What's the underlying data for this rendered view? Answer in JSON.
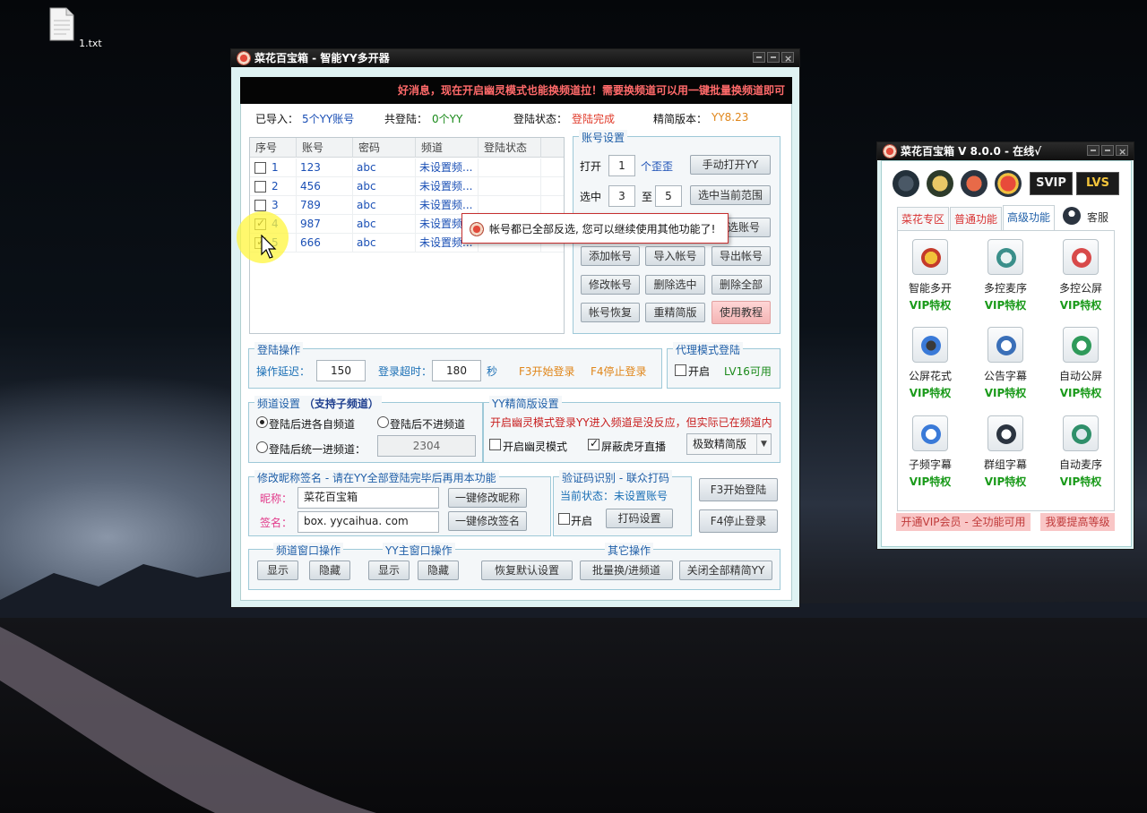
{
  "desktop": {
    "file_label": "1.txt"
  },
  "main_window": {
    "title": "菜花百宝箱 - 智能YY多开器",
    "marquee": "好消息，现在开启幽灵模式也能换频道拉！需要换频道可以用一键批量换频道即可",
    "status": {
      "imported_label": "已导入：",
      "imported_value": "5个YY账号",
      "total_label": "共登陆：",
      "total_value": "0个YY",
      "login_status_label": "登陆状态：",
      "login_status_value": "登陆完成",
      "version_label": "精简版本：",
      "version_value": "YY8.23"
    },
    "table": {
      "headers": [
        "序号",
        "账号",
        "密码",
        "频道",
        "登陆状态"
      ],
      "rows": [
        {
          "idx": "1",
          "account": "123",
          "password": "abc",
          "channel": "未设置频...",
          "checked": false
        },
        {
          "idx": "2",
          "account": "456",
          "password": "abc",
          "channel": "未设置频...",
          "checked": false
        },
        {
          "idx": "3",
          "account": "789",
          "password": "abc",
          "channel": "未设置频...",
          "checked": false
        },
        {
          "idx": "4",
          "account": "987",
          "password": "abc",
          "channel": "未设置频...",
          "checked": true
        },
        {
          "idx": "5",
          "account": "666",
          "password": "abc",
          "channel": "未设置频...",
          "checked": true
        }
      ]
    },
    "account_settings": {
      "group_title": "账号设置",
      "open_label": "打开",
      "open_value": "1",
      "open_unit": "个歪歪",
      "manual_open_button": "手动打开YY",
      "select_label": "选中",
      "select_from": "3",
      "select_to_label": "至",
      "select_to": "5",
      "select_range_button": "选中当前范围",
      "partial_button": "选账号",
      "add_button": "添加帐号",
      "import_button": "导入帐号",
      "export_button": "导出帐号",
      "modify_button": "修改帐号",
      "delete_selected_button": "删除选中",
      "delete_all_button": "删除全部",
      "restore_button": "帐号恢复",
      "recompact_button": "重精简版",
      "tutorial_button": "使用教程"
    },
    "login_ops": {
      "group_title": "登陆操作",
      "delay_label": "操作延迟：",
      "delay_value": "150",
      "timeout_label": "登录超时：",
      "timeout_value": "180",
      "timeout_unit": "秒",
      "f3_hint": "F3开始登录",
      "f4_hint": "F4停止登录"
    },
    "proxy": {
      "group_title": "代理模式登陆",
      "enable_label": "开启",
      "level_text": "LV16可用"
    },
    "channel_settings": {
      "group_title": "频道设置",
      "group_subtitle": "（支持子频道）",
      "opt1": "登陆后进各自频道",
      "opt2": "登陆后不进频道",
      "opt3": "登陆后统一进频道：",
      "channel_value": "2304"
    },
    "yy_compact": {
      "group_title": "YY精简版设置",
      "warning": "开启幽灵模式登录YY进入频道是没反应，但实际已在频道内",
      "ghost_label": "开启幽灵模式",
      "hide_huya_label": "屏蔽虎牙直播",
      "mode_value": "极致精简版"
    },
    "nickname": {
      "group_title": "修改昵称签名 - 请在YY全部登陆完毕后再用本功能",
      "nick_label": "昵称：",
      "nick_value": "菜花百宝箱",
      "nick_button": "一键修改昵称",
      "sign_label": "签名：",
      "sign_value": "box. yycaihua. com",
      "sign_button": "一键修改签名"
    },
    "captcha": {
      "group_title": "验证码识别 - 联众打码",
      "status_text": "当前状态：未设置账号",
      "enable_label": "开启",
      "settings_button": "打码设置"
    },
    "side_buttons": {
      "f3_button": "F3开始登陆",
      "f4_button": "F4停止登录"
    },
    "channel_window": {
      "group_title": "频道窗口操作",
      "show": "显示",
      "hide": "隐藏"
    },
    "yy_main_window": {
      "group_title": "YY主窗口操作",
      "show": "显示",
      "hide": "隐藏"
    },
    "other_ops": {
      "group_title": "其它操作",
      "reset_button": "恢复默认设置",
      "batch_button": "批量换/进频道",
      "close_all_button": "关闭全部精简YY"
    }
  },
  "toast": {
    "message": "帐号都已全部反选, 您可以继续使用其他功能了!"
  },
  "side_window": {
    "title": "菜花百宝箱 V 8.0.0 - 在线√",
    "svip_label": "SVIP",
    "lvs_label": "LVS",
    "tabs": [
      "菜花专区",
      "普通功能",
      "高级功能"
    ],
    "support_label": "客服",
    "features": [
      {
        "name": "智能多开",
        "vip": "VIP特权",
        "icon": "robot-icon"
      },
      {
        "name": "多控麦序",
        "vip": "VIP特权",
        "icon": "mixer-icon"
      },
      {
        "name": "多控公屏",
        "vip": "VIP特权",
        "icon": "chat-icon"
      },
      {
        "name": "公屏花式",
        "vip": "VIP特权",
        "icon": "traffic-light-icon"
      },
      {
        "name": "公告字幕",
        "vip": "VIP特权",
        "icon": "clipboard-icon"
      },
      {
        "name": "自动公屏",
        "vip": "VIP特权",
        "icon": "smiley-icon"
      },
      {
        "name": "子频字幕",
        "vip": "VIP特权",
        "icon": "window-icon"
      },
      {
        "name": "群组字幕",
        "vip": "VIP特权",
        "icon": "headset-icon"
      },
      {
        "name": "自动麦序",
        "vip": "VIP特权",
        "icon": "monitor-icon"
      }
    ],
    "footer_left": "开通VIP会员 - 全功能可用",
    "footer_right": "我要提高等级"
  }
}
